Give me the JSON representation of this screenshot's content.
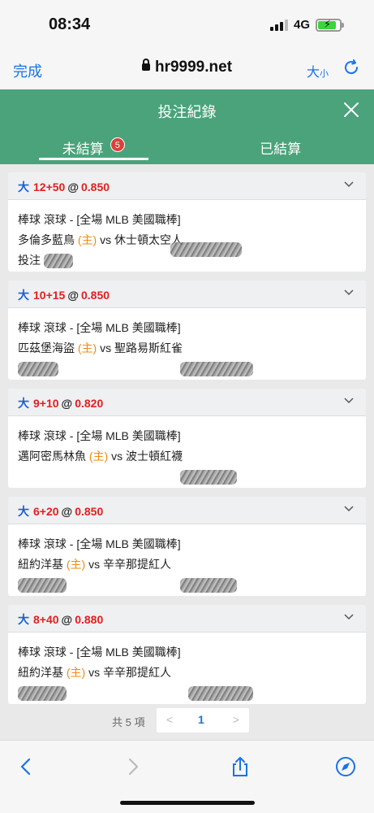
{
  "status": {
    "time": "08:34",
    "network": "4G"
  },
  "browser": {
    "done": "完成",
    "url": "hr9999.net",
    "text_size": "大",
    "text_size_small": "小"
  },
  "modal": {
    "title": "投注紀錄"
  },
  "tabs": [
    {
      "label": "未結算",
      "badge": "5"
    },
    {
      "label": "已結算"
    }
  ],
  "cards": [
    {
      "type": "大",
      "line": "12+50",
      "at": "@",
      "odds": "0.850",
      "league": "棒球 滾球 - [全場 MLB 美國職棒]",
      "home": "多倫多藍鳥",
      "home_tag": "(主)",
      "vs": "vs",
      "away": "休士頓太空人",
      "extra": "投注"
    },
    {
      "type": "大",
      "line": "10+15",
      "at": "@",
      "odds": "0.850",
      "league": "棒球 滾球 - [全場 MLB 美國職棒]",
      "home": "匹茲堡海盜",
      "home_tag": "(主)",
      "vs": "vs",
      "away": "聖路易斯紅雀",
      "extra": ""
    },
    {
      "type": "大",
      "line": "9+10",
      "at": "@",
      "odds": "0.820",
      "league": "棒球 滾球 - [全場 MLB 美國職棒]",
      "home": "邁阿密馬林魚",
      "home_tag": "(主)",
      "vs": "vs",
      "away": "波士頓紅襪",
      "extra": ""
    },
    {
      "type": "大",
      "line": "6+20",
      "at": "@",
      "odds": "0.850",
      "league": "棒球 滾球 - [全場 MLB 美國職棒]",
      "home": "紐約洋基",
      "home_tag": "(主)",
      "vs": "vs",
      "away": "辛辛那提紅人",
      "extra": ""
    },
    {
      "type": "大",
      "line": "8+40",
      "at": "@",
      "odds": "0.880",
      "league": "棒球 滾球 - [全場 MLB 美國職棒]",
      "home": "紐約洋基",
      "home_tag": "(主)",
      "vs": "vs",
      "away": "辛辛那提紅人",
      "extra": ""
    }
  ],
  "pagination": {
    "total": "共 5 項",
    "prev": "<",
    "page": "1",
    "next": ">"
  },
  "colors": {
    "header_green": "#4aa37a",
    "odds_red": "#e02020",
    "type_blue": "#1a5fd0",
    "home_orange": "#f08a14",
    "badge_red": "#d9423b",
    "ios_blue": "#1a73e8"
  },
  "icons": [
    "lock-icon",
    "reload-icon",
    "close-icon",
    "chevron-down-icon",
    "back-icon",
    "forward-icon",
    "share-icon",
    "compass-icon"
  ]
}
